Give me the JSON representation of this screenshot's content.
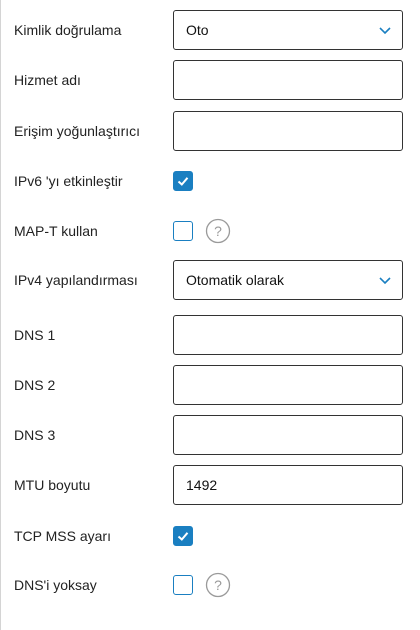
{
  "form": {
    "auth": {
      "label": "Kimlik doğrulama",
      "value": "Oto"
    },
    "service_name": {
      "label": "Hizmet adı",
      "value": ""
    },
    "access_concentrator": {
      "label": "Erişim yoğunlaştırıcı",
      "value": ""
    },
    "ipv6": {
      "label": "IPv6 'yı etkinleştir",
      "checked": true
    },
    "mapt": {
      "label": "MAP-T kullan",
      "checked": false,
      "help_icon": "question-circle-icon"
    },
    "ipv4_config": {
      "label": "IPv4 yapılandırması",
      "value": "Otomatik olarak"
    },
    "dns1": {
      "label": "DNS 1",
      "value": ""
    },
    "dns2": {
      "label": "DNS 2",
      "value": ""
    },
    "dns3": {
      "label": "DNS 3",
      "value": ""
    },
    "mtu": {
      "label": "MTU boyutu",
      "value": "1492"
    },
    "tcp_mss": {
      "label": "TCP MSS ayarı",
      "checked": true
    },
    "ignore_dns": {
      "label": "DNS'i yoksay",
      "checked": false,
      "help_icon": "question-circle-icon"
    }
  },
  "colors": {
    "accent": "#1a7fc1",
    "field_border": "#333333",
    "help_icon": "#9a9a9a"
  }
}
